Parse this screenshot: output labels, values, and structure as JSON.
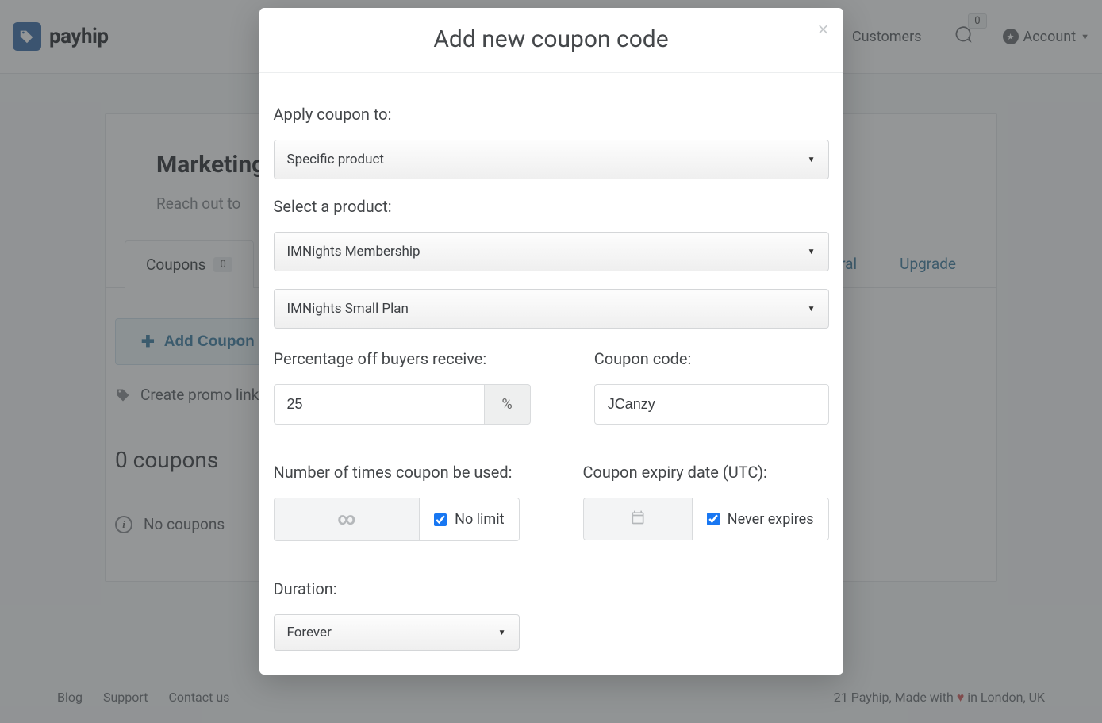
{
  "header": {
    "brand": "payhip",
    "nav": {
      "customers": "Customers",
      "messages_count": "0",
      "account": "Account"
    }
  },
  "page": {
    "title": "Marketing",
    "subtitle": "Reach out to"
  },
  "tabs": {
    "coupons": {
      "label": "Coupons",
      "count": "0"
    },
    "referral": "Referral",
    "upgrade": "Upgrade"
  },
  "actions": {
    "add_coupon": "Add Coupon",
    "promo_link": "Create promo link"
  },
  "listing": {
    "count_text": "0 coupons",
    "empty_text": "No coupons"
  },
  "footer": {
    "blog": "Blog",
    "support": "Support",
    "contact": "Contact us",
    "made": "21 Payhip, Made with",
    "made_suffix": "in London, UK"
  },
  "modal": {
    "title": "Add new coupon code",
    "labels": {
      "apply_to": "Apply coupon to:",
      "select_product": "Select a product:",
      "percentage": "Percentage off buyers receive:",
      "code": "Coupon code:",
      "times": "Number of times coupon be used:",
      "expiry": "Coupon expiry date (UTC):",
      "duration": "Duration:"
    },
    "values": {
      "apply_to": "Specific product",
      "product": "IMNights Membership",
      "plan": "IMNights Small Plan",
      "percentage": "25",
      "percent_sign": "%",
      "code": "JCanzy",
      "no_limit": "No limit",
      "never_expires": "Never expires",
      "duration": "Forever"
    }
  }
}
